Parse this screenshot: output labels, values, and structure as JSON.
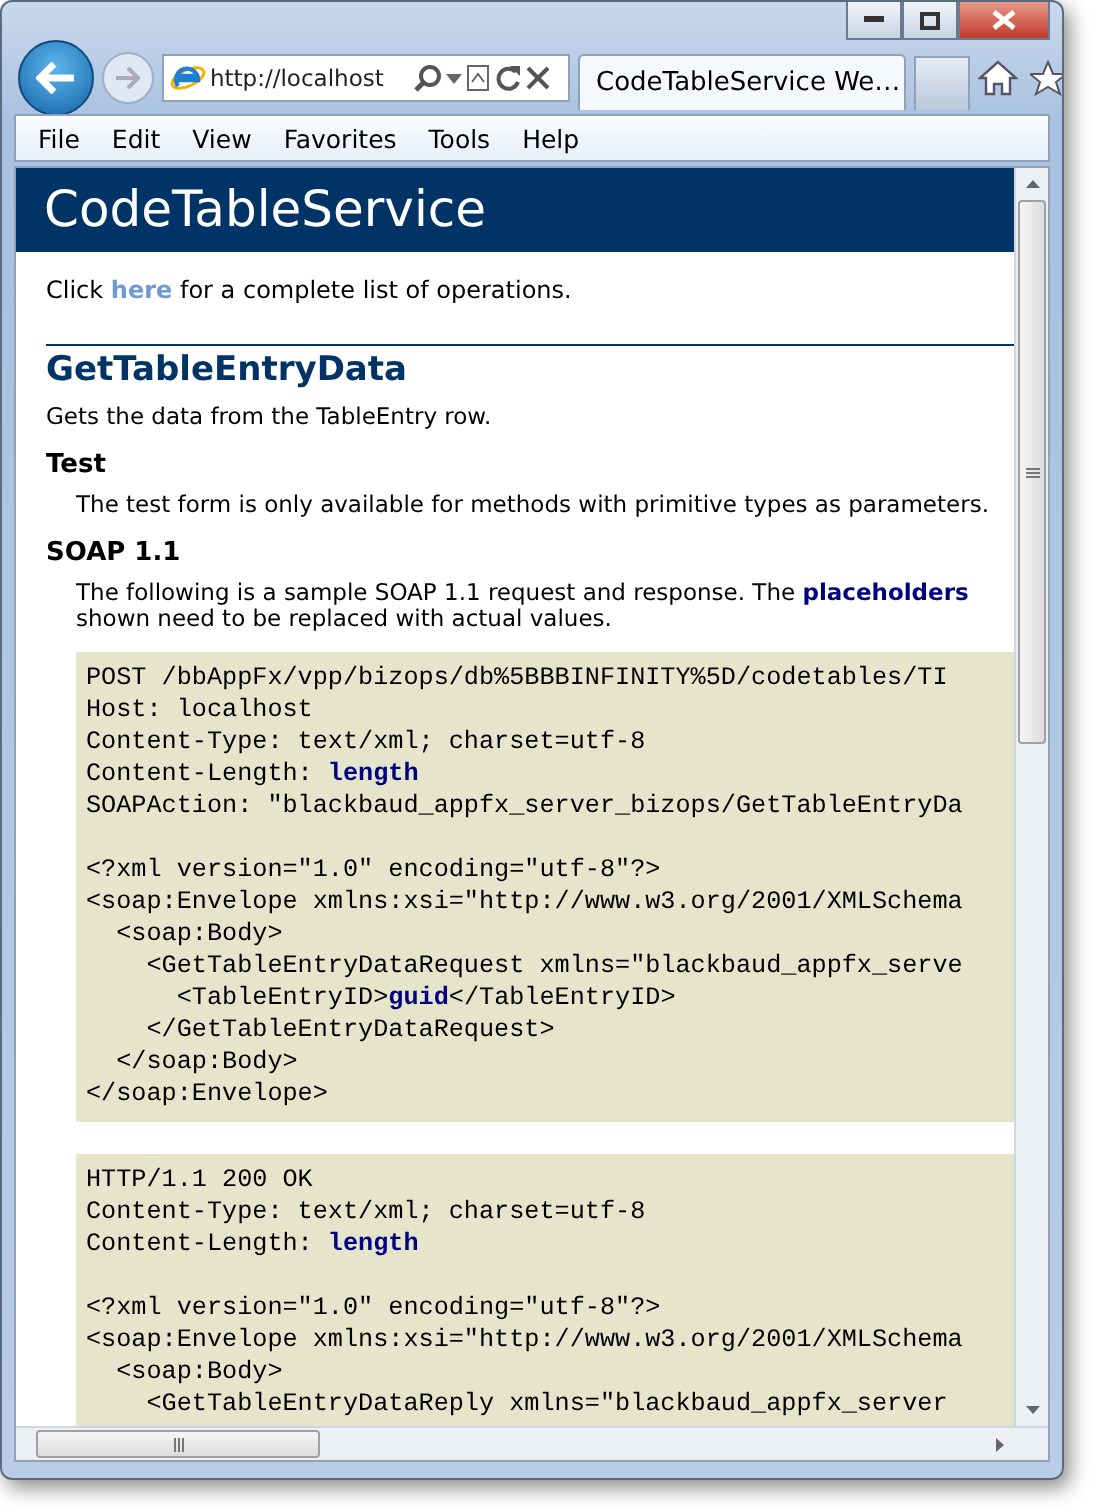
{
  "address_bar": {
    "value": "http://localhost"
  },
  "tabs": [
    {
      "label": "CodeTableService We…",
      "selected": true
    }
  ],
  "menu": [
    "File",
    "Edit",
    "View",
    "Favorites",
    "Tools",
    "Help"
  ],
  "page": {
    "banner": "CodeTableService",
    "intro": {
      "before": "Click ",
      "link": "here",
      "after": " for a complete list of operations."
    },
    "operation": "GetTableEntryData",
    "description": "Gets the data from the TableEntry row.",
    "sections": [
      {
        "heading": "Test",
        "text": "The test form is only available for methods with primitive types as parameters."
      },
      {
        "heading": "SOAP 1.1",
        "text": "The following is a sample SOAP 1.1 request and response. The **placeholders** shown need to be replaced with actual values."
      }
    ],
    "code_blocks": [
      [
        [
          "POST /bbAppFx/vpp/bizops/db%5BBBINFINITY%5D/codetables/TI",
          "Host: localhost",
          "Content-Type: text/xml; charset=utf-8",
          "Content-Length: **length**",
          "SOAPAction: \"blackbaud_appfx_server_bizops/GetTableEntryDa"
        ],
        [
          "<?xml version=\"1.0\" encoding=\"utf-8\"?>",
          "<soap:Envelope xmlns:xsi=\"http://www.w3.org/2001/XMLSchema",
          "  <soap:Body>",
          "    <GetTableEntryDataRequest xmlns=\"blackbaud_appfx_serve",
          "      <TableEntryID>**guid**</TableEntryID>",
          "    </GetTableEntryDataRequest>",
          "  </soap:Body>",
          "</soap:Envelope>"
        ]
      ],
      [
        [
          "HTTP/1.1 200 OK",
          "Content-Type: text/xml; charset=utf-8",
          "Content-Length: **length**"
        ],
        [
          "<?xml version=\"1.0\" encoding=\"utf-8\"?>",
          "<soap:Envelope xmlns:xsi=\"http://www.w3.org/2001/XMLSchema",
          "  <soap:Body>",
          "    <GetTableEntryDataReply xmlns=\"blackbaud_appfx_server"
        ]
      ]
    ]
  }
}
